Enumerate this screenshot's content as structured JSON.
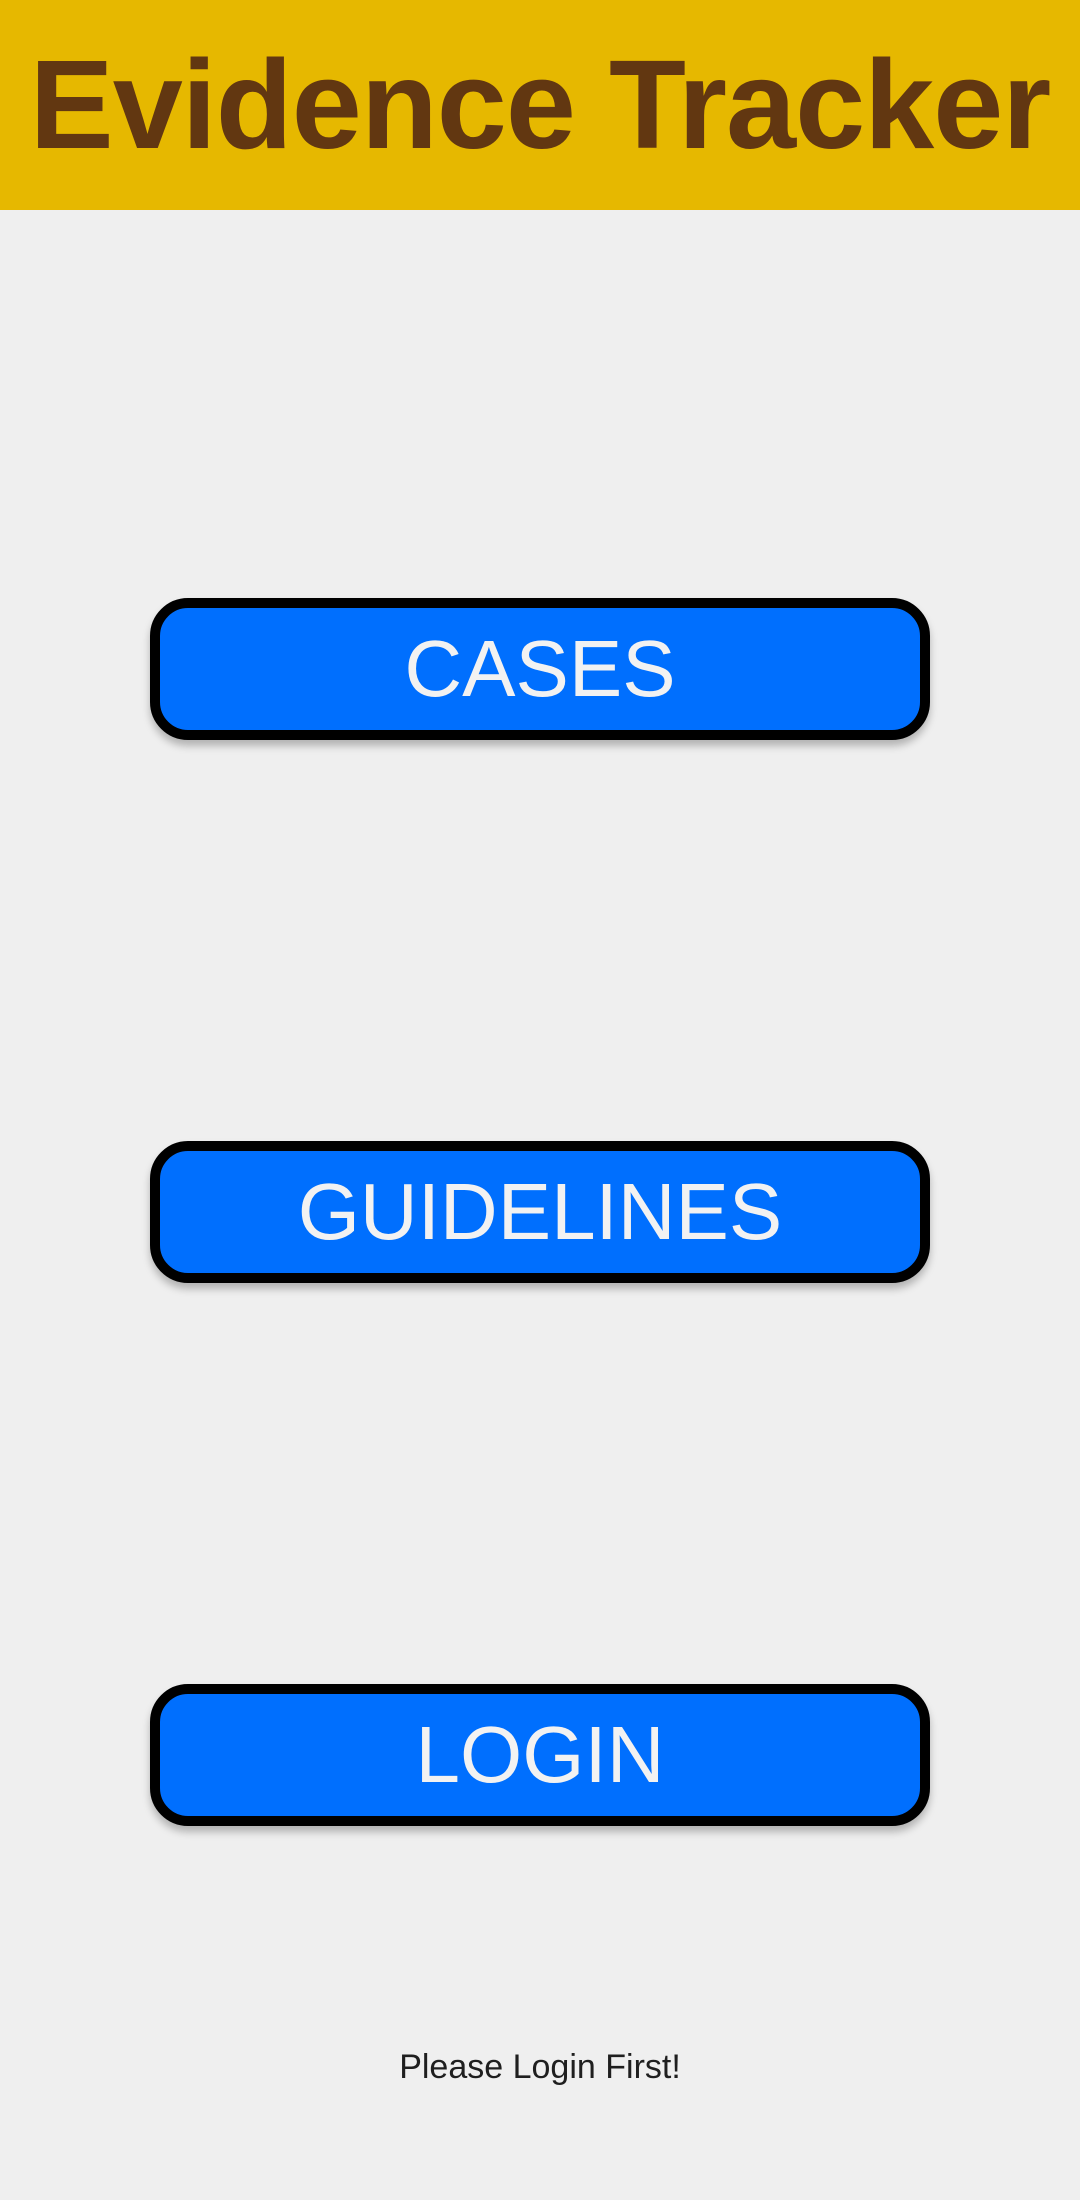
{
  "app": {
    "title": "Evidence Tracker"
  },
  "menu": {
    "cases_label": "CASES",
    "guidelines_label": "GUIDELINES",
    "login_label": "LOGIN"
  },
  "status": {
    "message": "Please Login First!"
  },
  "colors": {
    "header_background": "#e6b800",
    "header_text": "#623711",
    "button_background": "#006ffe",
    "button_border": "#000000",
    "button_text": "#f2f2f2",
    "page_background": "#efefef"
  }
}
